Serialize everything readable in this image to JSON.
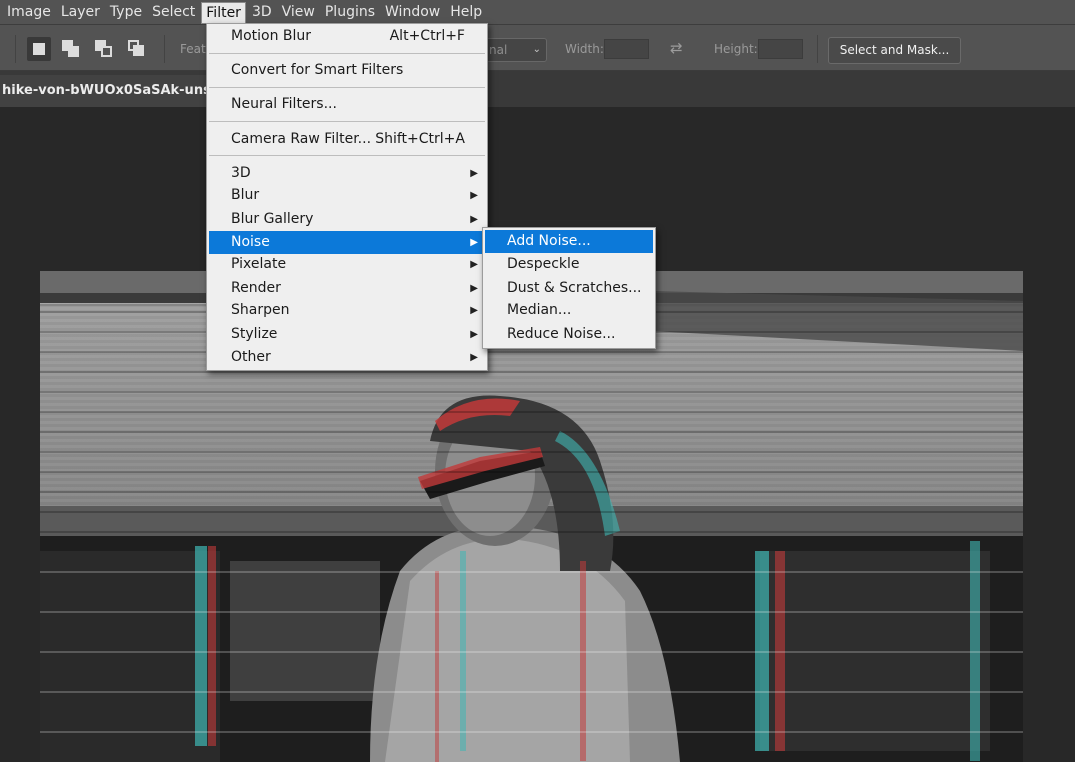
{
  "menubar": {
    "items": [
      "Image",
      "Layer",
      "Type",
      "Select",
      "Filter",
      "3D",
      "View",
      "Plugins",
      "Window",
      "Help"
    ],
    "active": "Filter"
  },
  "options": {
    "feather_label": "Feat",
    "style_value": "nal",
    "width_label": "Width:",
    "height_label": "Height:",
    "select_mask": "Select and Mask..."
  },
  "document": {
    "tab_title": "hike-von-bWUOx0SaSAk-unsplas"
  },
  "filter_menu": {
    "motion_blur": {
      "label": "Motion Blur",
      "shortcut": "Alt+Ctrl+F"
    },
    "convert_smart": {
      "label": "Convert for Smart Filters"
    },
    "neural": {
      "label": "Neural Filters..."
    },
    "camera_raw": {
      "label": "Camera Raw Filter...",
      "shortcut": "Shift+Ctrl+A"
    },
    "submenus": [
      "3D",
      "Blur",
      "Blur Gallery",
      "Noise",
      "Pixelate",
      "Render",
      "Sharpen",
      "Stylize",
      "Other"
    ],
    "highlighted": "Noise"
  },
  "noise_submenu": {
    "items": [
      "Add Noise...",
      "Despeckle",
      "Dust & Scratches...",
      "Median...",
      "Reduce Noise..."
    ],
    "highlighted": "Add Noise..."
  },
  "colors": {
    "menu_highlight": "#0c79d9",
    "menubar_bg": "#535353",
    "canvas_bg": "#282828",
    "menu_bg": "#efefef"
  }
}
